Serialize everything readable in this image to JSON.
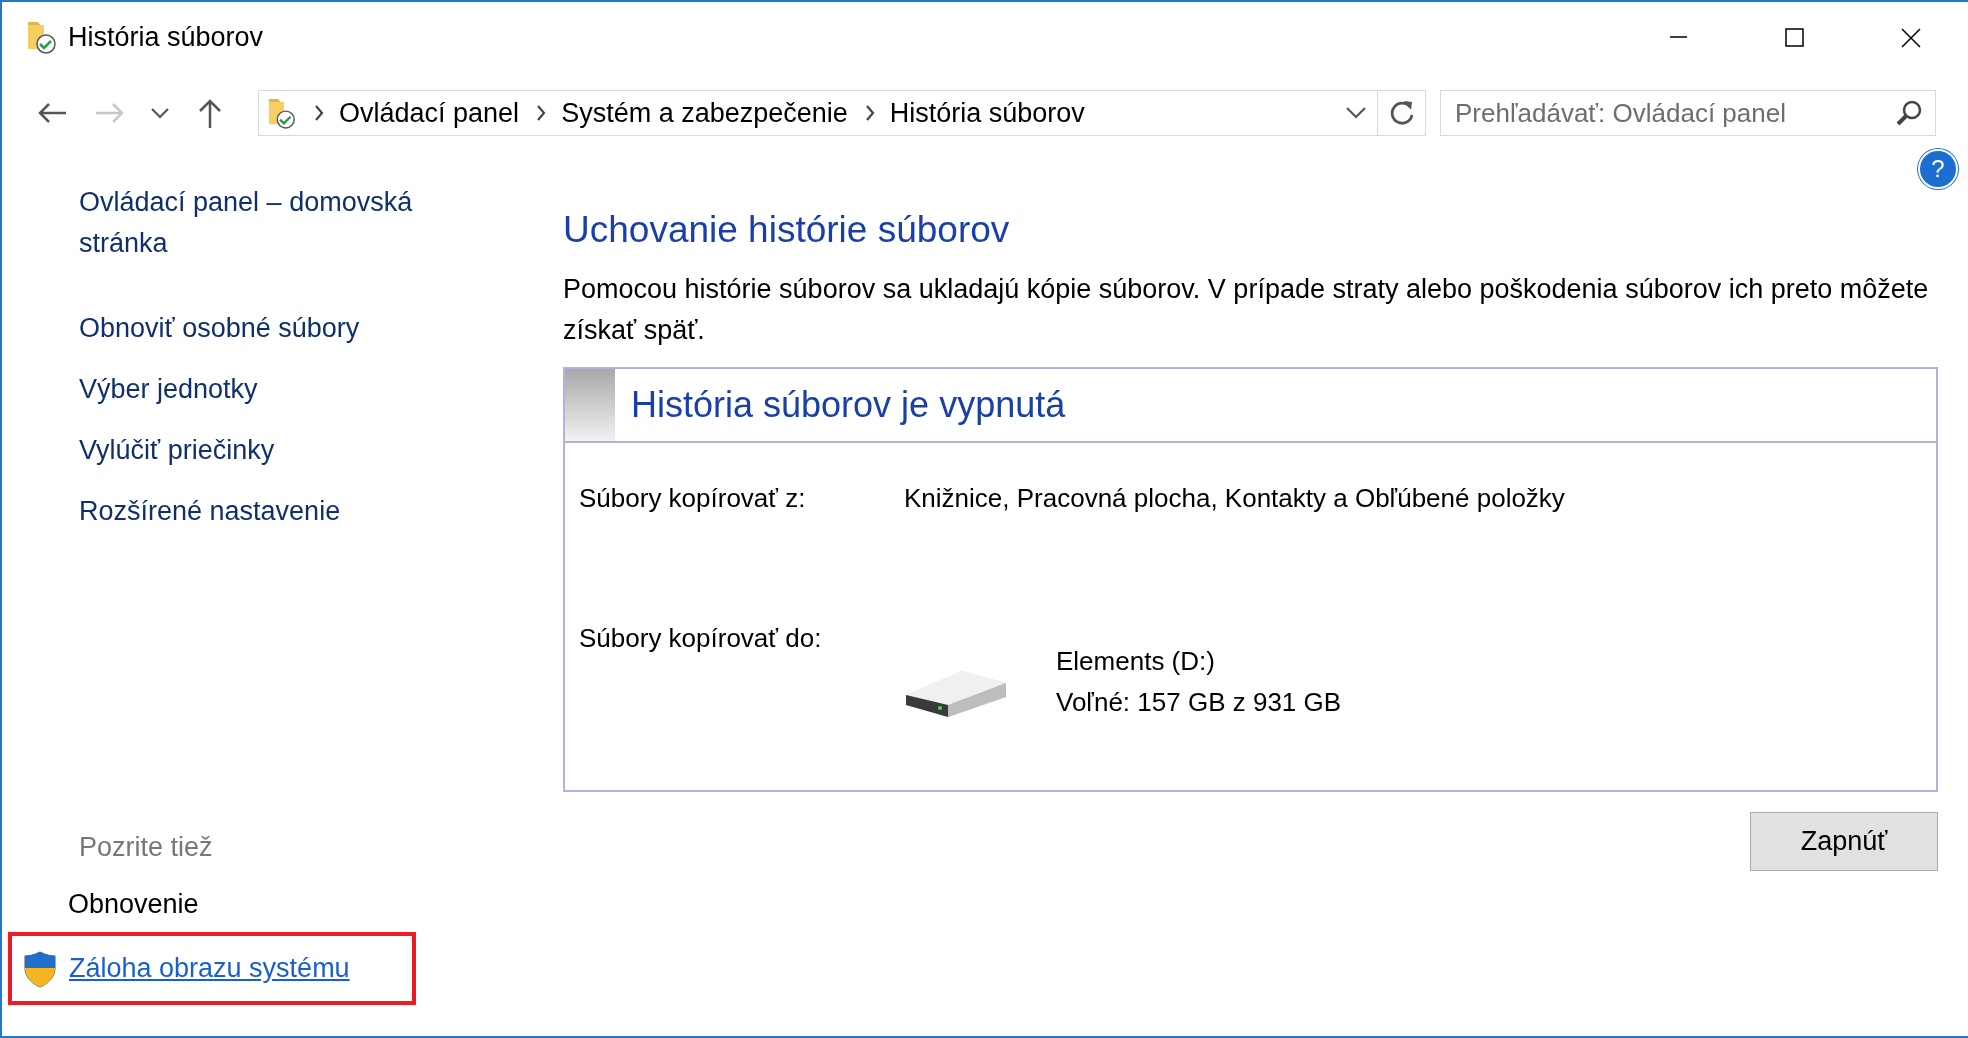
{
  "window": {
    "title": "História súborov"
  },
  "navigation": {
    "forward_disabled": true
  },
  "address_bar": {
    "breadcrumbs": [
      "Ovládací panel",
      "Systém a zabezpečenie",
      "História súborov"
    ]
  },
  "search": {
    "placeholder": "Prehľadávať: Ovládací panel"
  },
  "help": {
    "label": "?"
  },
  "sidebar": {
    "items": [
      {
        "label": "Ovládací panel – domovská stránka"
      },
      {
        "label": "Obnoviť osobné súbory"
      },
      {
        "label": "Výber jednotky"
      },
      {
        "label": "Vylúčiť priečinky"
      },
      {
        "label": "Rozšírené nastavenie"
      }
    ],
    "see_also_heading": "Pozrite tiež",
    "see_also": [
      {
        "label": "Obnovenie",
        "kind": "plain",
        "highlighted": false
      },
      {
        "label": "Záloha obrazu systému",
        "kind": "shield_link",
        "highlighted": true
      }
    ]
  },
  "main": {
    "heading": "Uchovanie histórie súborov",
    "description": "Pomocou histórie súborov sa ukladajú kópie súborov. V prípade straty alebo poškodenia súborov ich preto môžete získať späť.",
    "status_panel": {
      "title": "História súborov je vypnutá",
      "source": {
        "label": "Súbory kopírovať z:",
        "value": "Knižnice, Pracovná plocha, Kontakty a Obľúbené položky"
      },
      "destination": {
        "label": "Súbory kopírovať do:",
        "drive_name": "Elements (D:)",
        "free_space": "Voľné: 157 GB z 931 GB"
      }
    },
    "button": "Zapnúť"
  }
}
